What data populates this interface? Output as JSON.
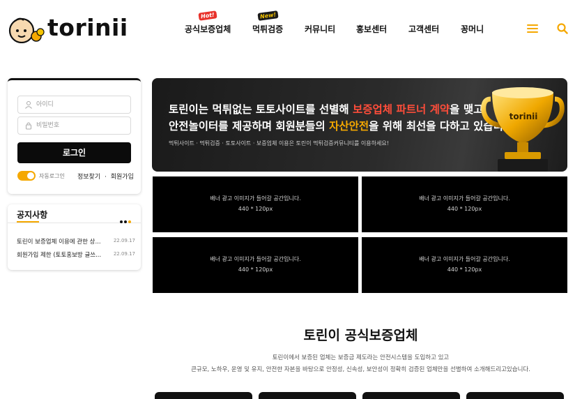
{
  "brand": {
    "name": "torinii"
  },
  "nav": {
    "items": [
      {
        "label": "공식보증업체",
        "badge": "Hot!"
      },
      {
        "label": "먹튀검증",
        "badge": "New!"
      },
      {
        "label": "커뮤니티"
      },
      {
        "label": "홍보센터"
      },
      {
        "label": "고객센터"
      },
      {
        "label": "꽁머니"
      }
    ]
  },
  "login": {
    "id_placeholder": "아이디",
    "pw_placeholder": "비밀번호",
    "button": "로그인",
    "auto_login": "자동로그인",
    "find_info": "정보찾기",
    "separator": "·",
    "signup": "회원가입"
  },
  "notice": {
    "title": "공지사항",
    "items": [
      {
        "title": "토린이 보증업체 이용에 관한 상...",
        "date": "22.09.17"
      },
      {
        "title": "회원가입 제한 (토토홍보방 글쓰...",
        "date": "22.09.17"
      }
    ]
  },
  "hero": {
    "line1_a": "토린이는 먹튀없는 토토사이트를 선별해 ",
    "line1_b": "보증업체 파트너 계약",
    "line1_c": "을 맺고",
    "line2_a": "안전놀이터를 제공하며 회원분들의 ",
    "line2_b": "자산안전",
    "line2_c": "을 위해 최선을 다하고 있습니다.",
    "sub": "먹튀사이트 · 먹튀검증 · 토토사이트 · 보증업체 이용은 토린이 먹튀검증커뮤니티를 이용하세요!",
    "trophy_brand": "torinii"
  },
  "banners": [
    {
      "text": "배너 광고 이미지가 들어갈 공간입니다.",
      "size": "440 * 120px"
    },
    {
      "text": "배너 광고 이미지가 들어갈 공간입니다.",
      "size": "440 * 120px"
    },
    {
      "text": "배너 광고 이미지가 들어갈 공간입니다.",
      "size": "440 * 120px"
    },
    {
      "text": "배너 광고 이미지가 들어갈 공간입니다.",
      "size": "440 * 120px"
    }
  ],
  "section": {
    "title": "토린이 공식보증업체",
    "line1": "토린이에서 보증된 업체는 보증금 제도라는 안전시스템을 도입하고 있고",
    "line2": "큰규모, 노하우, 운영 및 유지, 안전한 자본을 바탕으로 안정성, 신속성, 보안성이 정확히 검증된 업체만을 선별하여 소개해드리고있습니다."
  },
  "colors": {
    "accent": "#f5a800",
    "dark": "#0b0b0b",
    "hot": "#e8322b"
  }
}
